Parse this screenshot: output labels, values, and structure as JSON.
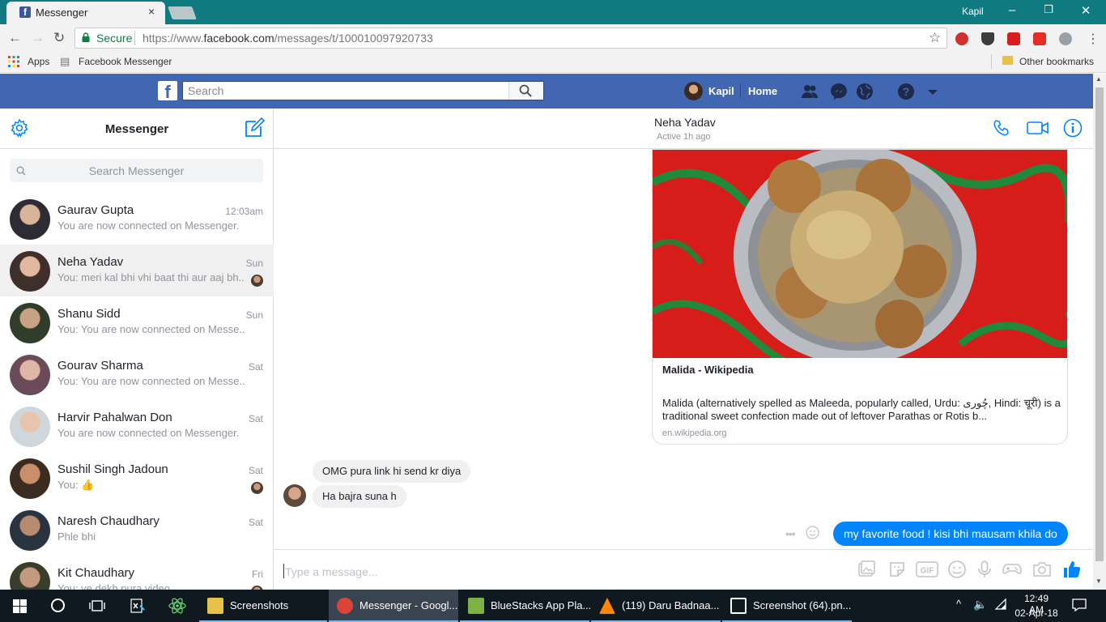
{
  "browser": {
    "tab_title": "Messenger",
    "tab_close": "×",
    "window_user": "Kapil",
    "window_controls": [
      "–",
      "❐",
      "✕"
    ],
    "secure_label": "Secure",
    "url_prefix": "https://www.",
    "url_domain": "facebook.com",
    "url_path": "/messages/t/100010097920733",
    "bookmarks": {
      "apps_label": "Apps",
      "facebook_messenger_label": "Facebook Messenger",
      "other_bookmarks_label": "Other bookmarks"
    },
    "extensions": [
      "abp-icon",
      "shield-icon",
      "video-icon",
      "youtube-icon",
      "cloud-icon"
    ]
  },
  "fb_header": {
    "search_placeholder": "Search",
    "user_name": "Kapil",
    "home_label": "Home"
  },
  "messenger": {
    "title": "Messenger",
    "search_placeholder": "Search Messenger",
    "conversations": [
      {
        "name": "Gaurav Gupta",
        "snippet": "You are now connected on Messenger.",
        "time": "12:03am",
        "selected": false
      },
      {
        "name": "Neha Yadav",
        "snippet": "You: meri kal bhi vhi baat thi aur aaj bh...",
        "time": "Sun",
        "selected": true
      },
      {
        "name": "Shanu Sidd",
        "snippet": "You: You are now connected on Messe...",
        "time": "Sun",
        "selected": false
      },
      {
        "name": "Gourav Sharma",
        "snippet": "You: You are now connected on Messe...",
        "time": "Sat",
        "selected": false
      },
      {
        "name": "Harvir Pahalwan Don",
        "snippet": "You are now connected on Messenger.",
        "time": "Sat",
        "selected": false
      },
      {
        "name": "Sushil Singh Jadoun",
        "snippet": "You: 👍",
        "time": "Sat",
        "selected": false
      },
      {
        "name": "Naresh Chaudhary",
        "snippet": "Phle bhi",
        "time": "Sat",
        "selected": false
      },
      {
        "name": "Kit Chaudhary",
        "snippet": "You: ye dekh pura video",
        "time": "Fri",
        "selected": false
      }
    ]
  },
  "chat": {
    "contact_name": "Neha Yadav",
    "contact_status": "Active 1h ago",
    "link_card": {
      "title": "Malida - Wikipedia",
      "description": "Malida (alternatively spelled as Maleeda, popularly called, Urdu: چُوری, Hindi: चूरी) is a traditional sweet confection made out of leftover Parathas or Rotis b...",
      "domain": "en.wikipedia.org"
    },
    "messages": [
      {
        "from": "them",
        "text": "OMG pura link hi send kr diya"
      },
      {
        "from": "them",
        "text": "Ha bajra suna h"
      },
      {
        "from": "me",
        "text": "my favorite food ! kisi bhi mausam khila do"
      }
    ],
    "more_label": "•••",
    "composer_placeholder": "Type a message...",
    "composer_icons": [
      "image-icon",
      "sticker-icon",
      "gif-icon",
      "emoji-icon",
      "microphone-icon",
      "game-icon",
      "camera-icon",
      "thumbs-up-icon"
    ],
    "accent_color": "#0084ff"
  },
  "taskbar": {
    "items": [
      {
        "label": "Screenshots",
        "icon": "folder-icon",
        "active": false
      },
      {
        "label": "Messenger - Googl...",
        "icon": "chrome-icon",
        "active": true
      },
      {
        "label": "BlueStacks App Pla...",
        "icon": "bluestacks-icon",
        "active": false
      },
      {
        "label": "(119) Daru Badnaa...",
        "icon": "vlc-icon",
        "active": false
      },
      {
        "label": "Screenshot (64).pn...",
        "icon": "photos-icon",
        "active": false
      }
    ],
    "time": "12:49 AM",
    "date": "02-Apr-18"
  },
  "colors": {
    "fb_blue": "#4267b2",
    "chrome_teal": "#0f7a80",
    "messenger_blue": "#0084ff"
  }
}
